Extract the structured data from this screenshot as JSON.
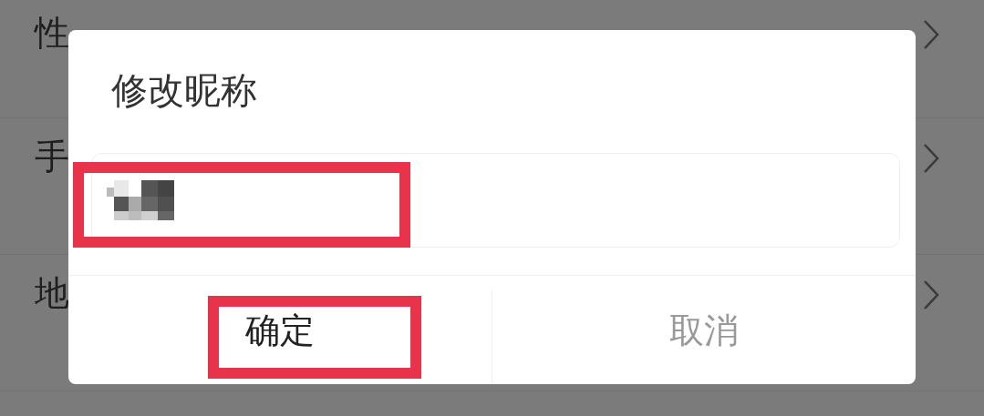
{
  "background_rows": [
    {
      "label": "性"
    },
    {
      "label": "手"
    },
    {
      "label": "地"
    }
  ],
  "dialog": {
    "title": "修改昵称",
    "field": {
      "kind": "mosaic",
      "highlighted": true
    },
    "buttons": [
      {
        "label": "确定",
        "kind": "confirm",
        "highlighted": true
      },
      {
        "label": "取消",
        "kind": "cancel",
        "highlighted": false
      }
    ]
  }
}
